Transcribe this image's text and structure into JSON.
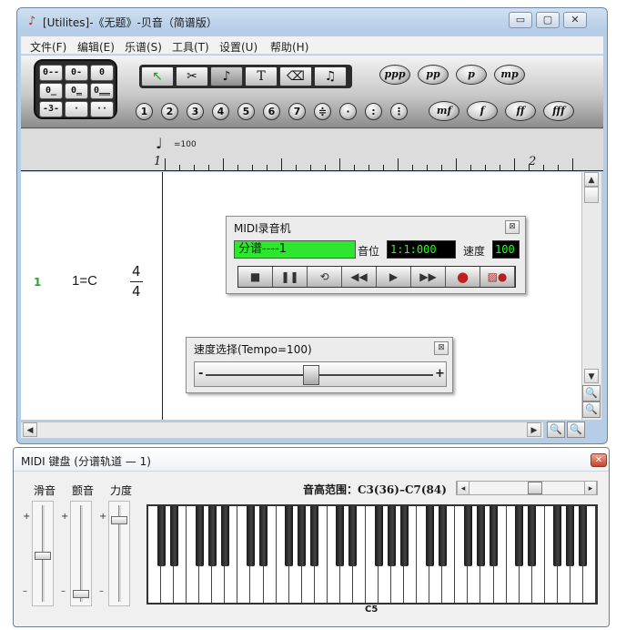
{
  "window": {
    "title": "[Utilites]-《无题》-贝音（简谱版）",
    "menu": [
      "文件(F)",
      "编辑(E)",
      "乐谱(S)",
      "工具(T)",
      "设置(U)",
      "帮助(H)"
    ],
    "buttons": {
      "minimize": "▭",
      "maximize": "▢",
      "close": "✕"
    }
  },
  "toolbar": {
    "durations": [
      "0---",
      "0-",
      "0",
      "0̲",
      "0̳",
      "0̳̳",
      "-3-",
      "·",
      "··"
    ],
    "tools": [
      "↖",
      "✂",
      "♪",
      "T",
      "⌫",
      "♫"
    ],
    "dynamics_row1": [
      "ppp",
      "pp",
      "p",
      "mp"
    ],
    "dynamics_row2": [
      "mf",
      "f",
      "ff",
      "fff"
    ],
    "numbers": [
      "1",
      "2",
      "3",
      "4",
      "5",
      "6",
      "7",
      "≑",
      "·",
      ":",
      "⋮"
    ]
  },
  "ruler": {
    "tempo": "=100",
    "measure1": "1",
    "measure2": "2"
  },
  "score": {
    "track_number": "1",
    "key": "1=C",
    "time_sig_top": "4",
    "time_sig_bottom": "4"
  },
  "midi_recorder": {
    "title": "MIDI录音机",
    "track_value": "分谱----1",
    "position_label": "音位",
    "position_value": "1:1:000",
    "tempo_label": "速度",
    "tempo_value": "100",
    "transport": [
      "■",
      "❚❚",
      "⟲",
      "◀◀",
      "▶",
      "▶▶",
      "●",
      "▨●"
    ],
    "colors": {
      "track_bg": "#2ee62e",
      "display_bg": "#000000",
      "display_fg": "#22ff22"
    }
  },
  "tempo_panel": {
    "title": "速度选择(Tempo=100)",
    "minus": "-",
    "plus": "+",
    "level": 0.46
  },
  "keyboard": {
    "title": "MIDI 键盘 (分谱轨道 — 1)",
    "close": "✕",
    "sliders": [
      {
        "label": "滑音",
        "plus": "+",
        "minus": "–",
        "level": 0.48
      },
      {
        "label": "颤音",
        "plus": "+",
        "minus": "–",
        "level": 0.05
      },
      {
        "label": "力度",
        "plus": "+",
        "minus": "–",
        "level": 0.88
      }
    ],
    "range_label": "音高范围：C3(36)–C7(84)",
    "range_left": "◂",
    "range_right": "▸",
    "range_level": 0.58,
    "middle_c": "C5",
    "white_keys": 35
  }
}
